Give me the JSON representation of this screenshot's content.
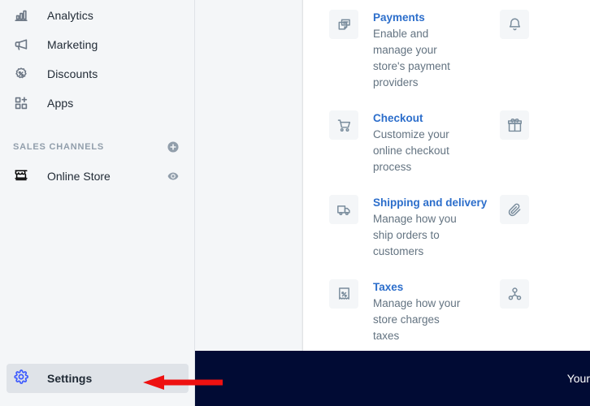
{
  "sidebar": {
    "nav_items": [
      {
        "label": "Analytics",
        "icon": "analytics-icon"
      },
      {
        "label": "Marketing",
        "icon": "marketing-megaphone-icon"
      },
      {
        "label": "Discounts",
        "icon": "discounts-badge-icon"
      },
      {
        "label": "Apps",
        "icon": "apps-grid-icon"
      }
    ],
    "section": {
      "title": "SALES CHANNELS",
      "add_icon": "plus-circle-icon"
    },
    "channels": [
      {
        "label": "Online Store",
        "icon": "storefront-icon",
        "trailing_icon": "eye-icon"
      }
    ],
    "settings": {
      "label": "Settings",
      "icon": "gear-icon"
    }
  },
  "main": {
    "settings_card": {
      "items": [
        {
          "title": "Payments",
          "description": "Enable and manage your store's payment providers",
          "icon": "payments-cards-icon",
          "column": "left"
        },
        {
          "title": "",
          "description": "",
          "icon": "notifications-bell-icon",
          "column": "right"
        },
        {
          "title": "Checkout",
          "description": "Customize your online checkout process",
          "icon": "checkout-cart-icon",
          "column": "left"
        },
        {
          "title": "",
          "description": "",
          "icon": "gift-card-icon",
          "column": "right"
        },
        {
          "title": "Shipping and delivery",
          "description": "Manage how you ship orders to customers",
          "icon": "shipping-truck-icon",
          "column": "left"
        },
        {
          "title": "",
          "description": "",
          "icon": "files-paperclip-icon",
          "column": "right"
        },
        {
          "title": "Taxes",
          "description": "Manage how your store charges taxes",
          "icon": "taxes-receipt-icon",
          "column": "left"
        },
        {
          "title": "",
          "description": "",
          "icon": "account-user-icon",
          "column": "right"
        }
      ]
    }
  },
  "bottom_bar": {
    "text": "Your",
    "background_color": "#010b34"
  },
  "annotation": {
    "arrow_color": "#ee1111",
    "direction": "left",
    "points_at": "Settings"
  },
  "colors": {
    "accent_link": "#2c6ecb",
    "sidebar_bg": "#f4f6f8",
    "selected_bg": "#dfe3e8",
    "text_primary": "#212b36",
    "text_subdued": "#637381"
  }
}
